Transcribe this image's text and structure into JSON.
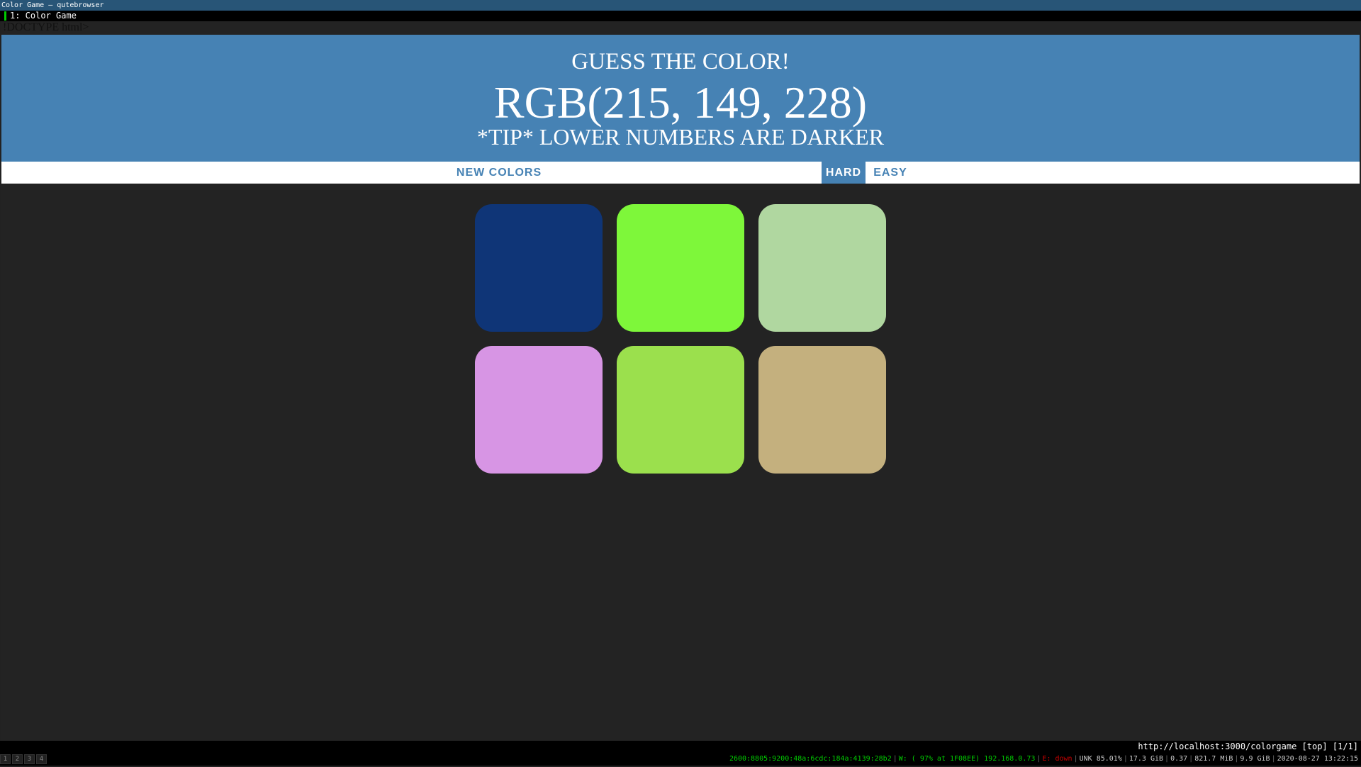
{
  "window": {
    "title": "Color Game – qutebrowser"
  },
  "tabs": [
    {
      "label": "1: Color Game"
    }
  ],
  "page": {
    "doctype_text": "!DOCTYPE html>",
    "header": {
      "title": "Guess the color!",
      "rgb": "RGB(215, 149, 228)",
      "tip": "*Tip* lower numbers are darker"
    },
    "controls": {
      "new_colors": "New Colors",
      "hard": "Hard",
      "easy": "Easy",
      "selected_mode": "Hard"
    },
    "squares": [
      {
        "color": "#0f3577"
      },
      {
        "color": "#7ef73a"
      },
      {
        "color": "#b0d7a0"
      },
      {
        "color": "#d795e4"
      },
      {
        "color": "#9be04d"
      },
      {
        "color": "#c4b07e"
      }
    ],
    "colors": {
      "header_bg": "#4682b4",
      "page_bg": "#232323",
      "accent": "#4682b4"
    }
  },
  "statusbar": {
    "url": "http://localhost:3000/colorgame [top] [1/1]"
  },
  "i3bar": {
    "workspaces": [
      "1",
      "2",
      "3",
      "4"
    ],
    "focused_workspace": "4",
    "status": {
      "ipv6": "2600:8805:9200:48a:6cdc:184a:4139:28b2",
      "wifi": "W: ( 97% at 1F08EE) 192.168.0.73",
      "ethernet": "E: down",
      "battery": "UNK 85.01%",
      "disk": "17.3 GiB",
      "load": "0.37",
      "memory": "821.7 MiB",
      "swap": "9.9 GiB",
      "datetime": "2020-08-27 13:22:15"
    }
  }
}
